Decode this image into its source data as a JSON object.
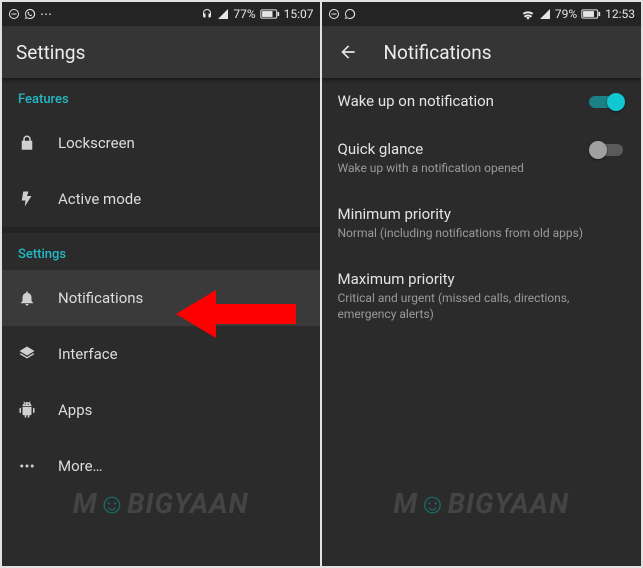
{
  "left": {
    "status": {
      "battery_pct": "77%",
      "time": "15:07"
    },
    "header": {
      "title": "Settings"
    },
    "sections": {
      "features": {
        "label": "Features",
        "items": {
          "lockscreen": "Lockscreen",
          "active_mode": "Active mode"
        }
      },
      "settings": {
        "label": "Settings",
        "items": {
          "notifications": "Notifications",
          "interface": "Interface",
          "apps": "Apps",
          "more": "More…"
        }
      }
    }
  },
  "right": {
    "status": {
      "battery_pct": "79%",
      "time": "12:53"
    },
    "header": {
      "title": "Notifications"
    },
    "prefs": {
      "wake": {
        "title": "Wake up on notification",
        "on": true
      },
      "glance": {
        "title": "Quick glance",
        "sub": "Wake up with a notification opened",
        "on": false
      },
      "minp": {
        "title": "Minimum priority",
        "sub": "Normal (including notifications from old apps)"
      },
      "maxp": {
        "title": "Maximum priority",
        "sub": "Critical and urgent (missed calls, directions, emergency alerts)"
      }
    }
  },
  "watermark_a": "M",
  "watermark_b": "BIGYAAN",
  "colors": {
    "accent": "#0fc8d2",
    "section": "#23b8c4"
  }
}
